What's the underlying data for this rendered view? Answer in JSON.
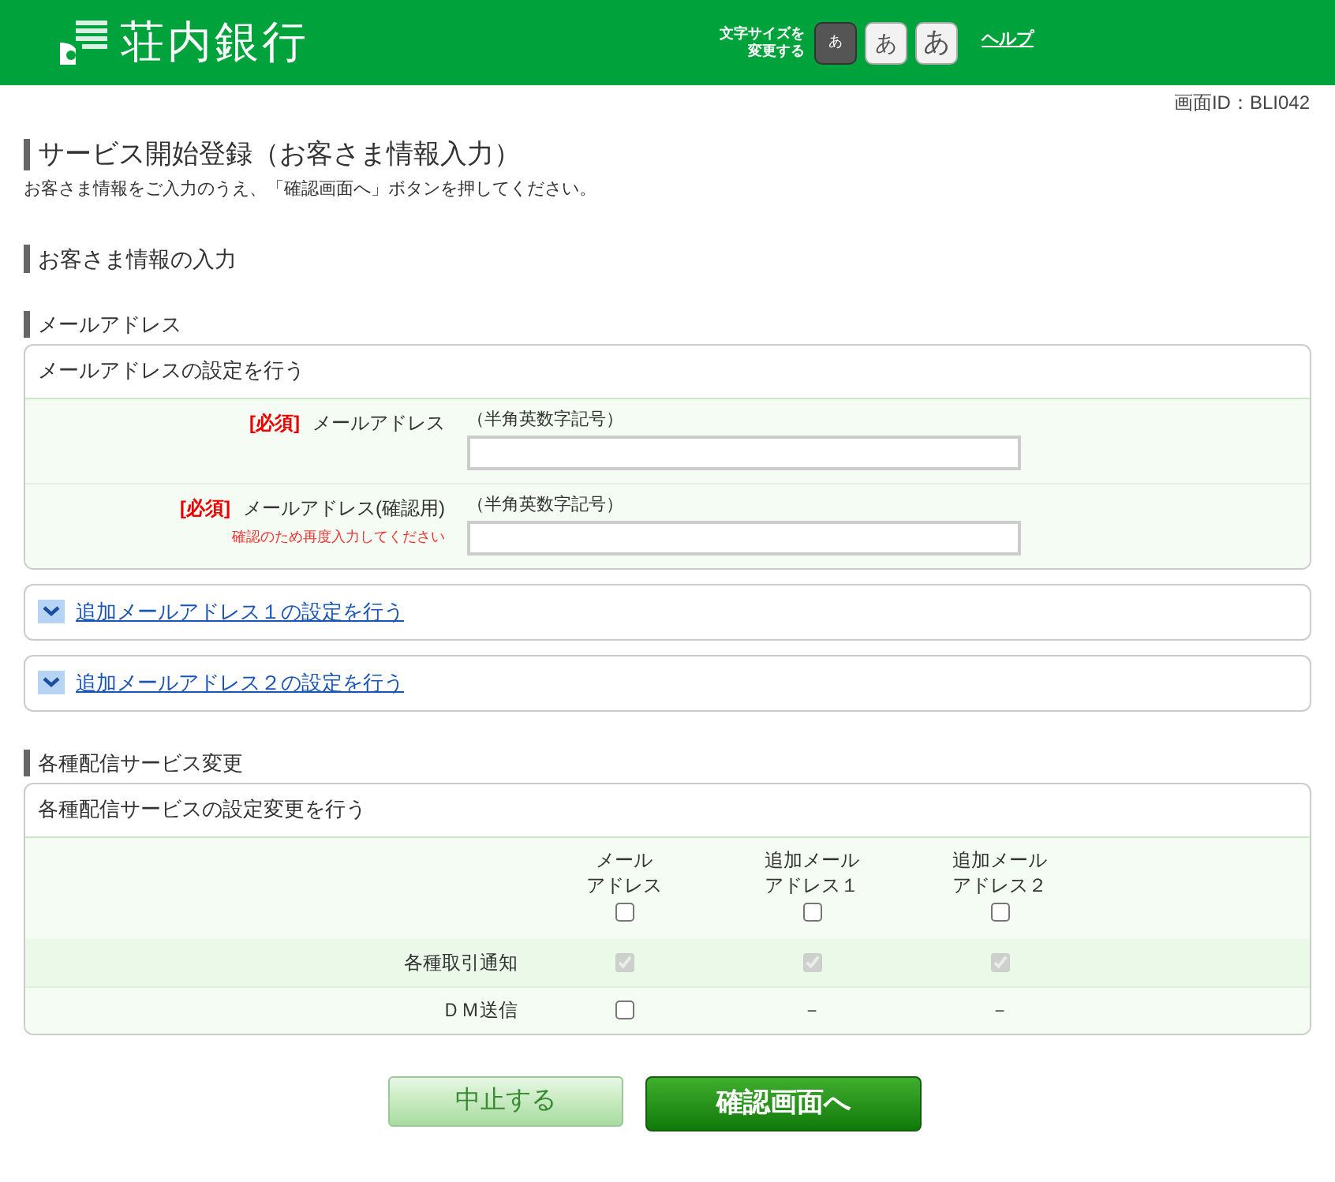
{
  "header": {
    "logo": "荘内銀行",
    "font_size_label": [
      "文字サイズを",
      "変更する"
    ],
    "font_sizes": [
      {
        "label": "あ",
        "kind": "small",
        "selected": true
      },
      {
        "label": "あ",
        "kind": "medium",
        "selected": false
      },
      {
        "label": "あ",
        "kind": "large",
        "selected": false
      }
    ],
    "help_link": "ヘルプ"
  },
  "screen_id": "画面ID：BLI042",
  "page_title": "サービス開始登録（お客さま情報入力）",
  "description": "お客さま情報をご入力のうえ、「確認画面へ」ボタンを押してください。",
  "section_title": "お客さま情報の入力",
  "email_section": {
    "heading": "メールアドレス",
    "card_title": "メールアドレスの設定を行う",
    "fields": [
      {
        "required": "[必須]",
        "label": "メールアドレス",
        "hint": "（半角英数字記号）"
      },
      {
        "required": "[必須]",
        "label": "メールアドレス(確認用)",
        "note": "確認のため再度入力してください",
        "hint": "（半角英数字記号）"
      }
    ],
    "expanders": [
      {
        "label": "追加メールアドレス１の設定を行う",
        "expanded": false
      },
      {
        "label": "追加メールアドレス２の設定を行う",
        "expanded": false
      }
    ]
  },
  "delivery_section": {
    "heading": "各種配信サービス変更",
    "card_title": "各種配信サービスの設定変更を行う",
    "columns": [
      {
        "lines": [
          "メール",
          "アドレス"
        ],
        "checked": false
      },
      {
        "lines": [
          "追加メール",
          "アドレス１"
        ],
        "checked": false
      },
      {
        "lines": [
          "追加メール",
          "アドレス２"
        ],
        "checked": false
      }
    ],
    "rows": [
      {
        "label": "各種取引通知",
        "cells": [
          {
            "kind": "checkbox",
            "checked": true,
            "disabled": true
          },
          {
            "kind": "checkbox",
            "checked": true,
            "disabled": true
          },
          {
            "kind": "checkbox",
            "checked": true,
            "disabled": true
          }
        ]
      },
      {
        "label": "ＤＭ送信",
        "cells": [
          {
            "kind": "checkbox",
            "checked": false,
            "disabled": false
          },
          {
            "kind": "dash",
            "text": "－"
          },
          {
            "kind": "dash",
            "text": "－"
          }
        ]
      }
    ]
  },
  "buttons": [
    {
      "label": "中止する",
      "kind": "secondary"
    },
    {
      "label": "確認画面へ",
      "kind": "primary"
    }
  ]
}
